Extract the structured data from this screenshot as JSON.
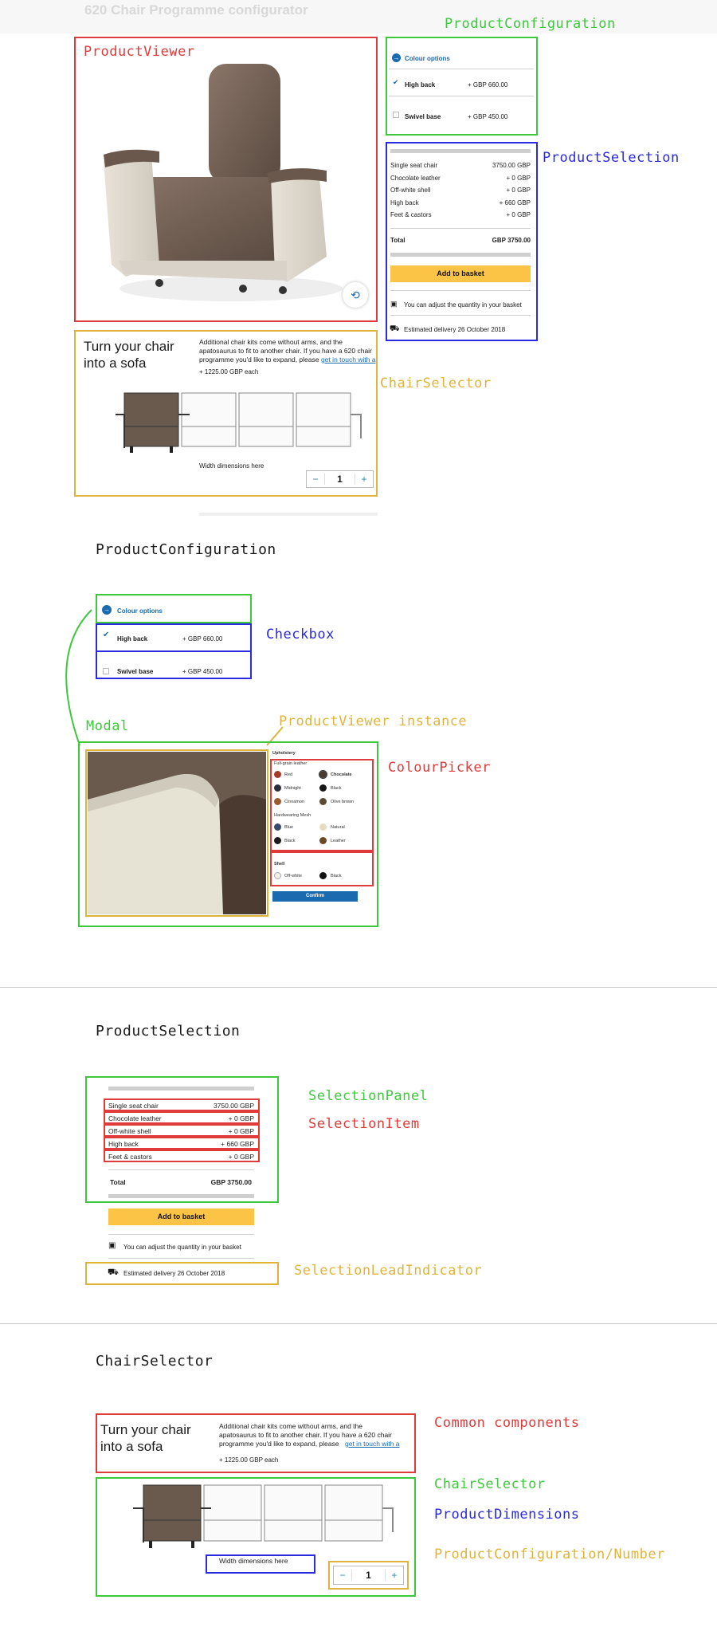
{
  "app_title": "620 Chair Programme configurator",
  "annotations": {
    "product_configuration": "ProductConfiguration",
    "product_viewer": "ProductViewer",
    "product_selection": "ProductSelection",
    "chair_selector": "ChairSelector",
    "checkbox": "Checkbox",
    "modal": "Modal",
    "product_viewer_instance": "ProductViewer instance",
    "colour_picker": "ColourPicker",
    "selection_panel": "SelectionPanel",
    "selection_item": "SelectionItem",
    "selection_lead_indicator": "SelectionLeadIndicator",
    "common_components": "Common components",
    "product_dimensions": "ProductDimensions",
    "number": "ProductConfiguration/Number"
  },
  "section_titles": {
    "configuration": "ProductConfiguration",
    "selection": "ProductSelection",
    "chair_selector": "ChairSelector"
  },
  "configuration": {
    "colour_options": "Colour options",
    "options": [
      {
        "label": "High back",
        "price": "+ GBP 660.00",
        "checked": true
      },
      {
        "label": "Swivel base",
        "price": "+ GBP 450.00",
        "checked": false
      }
    ]
  },
  "selection": {
    "items": [
      {
        "label": "Single seat chair",
        "price": "3750.00 GBP"
      },
      {
        "label": "Chocolate leather",
        "price": "+ 0 GBP"
      },
      {
        "label": "Off-white shell",
        "price": "+ 0 GBP"
      },
      {
        "label": "High back",
        "price": "+ 660 GBP"
      },
      {
        "label": "Feet & castors",
        "price": "+ 0 GBP"
      }
    ],
    "total_label": "Total",
    "total_value": "GBP 3750.00",
    "basket_label": "Add to basket",
    "quantity_note": "You can adjust the quantity in your basket",
    "delivery": "Estimated delivery 26 October 2018"
  },
  "chair_selector": {
    "heading_line1": "Turn your chair",
    "heading_line2": "into a sofa",
    "desc_text": "Additional chair kits come without arms, and the apatosaurus to fit to another chair. If you have a 620 chair programme you'd like to expand, please",
    "desc_link": "get in touch with a",
    "price": "+ 1225.00 GBP each",
    "dimensions": "Width dimensions here",
    "quantity": "1",
    "minus": "−",
    "plus": "+"
  },
  "colour_picker": {
    "upholstery": "Upholstery",
    "full_grain": "Full-grain leather",
    "swatches_leather": [
      {
        "name": "Red",
        "color": "#a83a2a"
      },
      {
        "name": "Chocolate",
        "color": "#4a3a30"
      },
      {
        "name": "Midnight",
        "color": "#2a2f3a"
      },
      {
        "name": "Black",
        "color": "#151515"
      },
      {
        "name": "Cinnamon",
        "color": "#9a5a32"
      },
      {
        "name": "Olive brown",
        "color": "#5a4a32"
      }
    ],
    "hardwearing": "Hardwearing Mesh",
    "swatches_mesh": [
      {
        "name": "Blue",
        "color": "#3a4a6a"
      },
      {
        "name": "Natural",
        "color": "#e8dcc0"
      },
      {
        "name": "Black",
        "color": "#1a1a1a"
      },
      {
        "name": "Leather",
        "color": "#6a4a22"
      }
    ],
    "shell": "Shell",
    "swatches_shell": [
      {
        "name": "Off-white",
        "color": "#f2efe8"
      },
      {
        "name": "Black",
        "color": "#111111"
      }
    ],
    "confirm": "Confirm"
  }
}
